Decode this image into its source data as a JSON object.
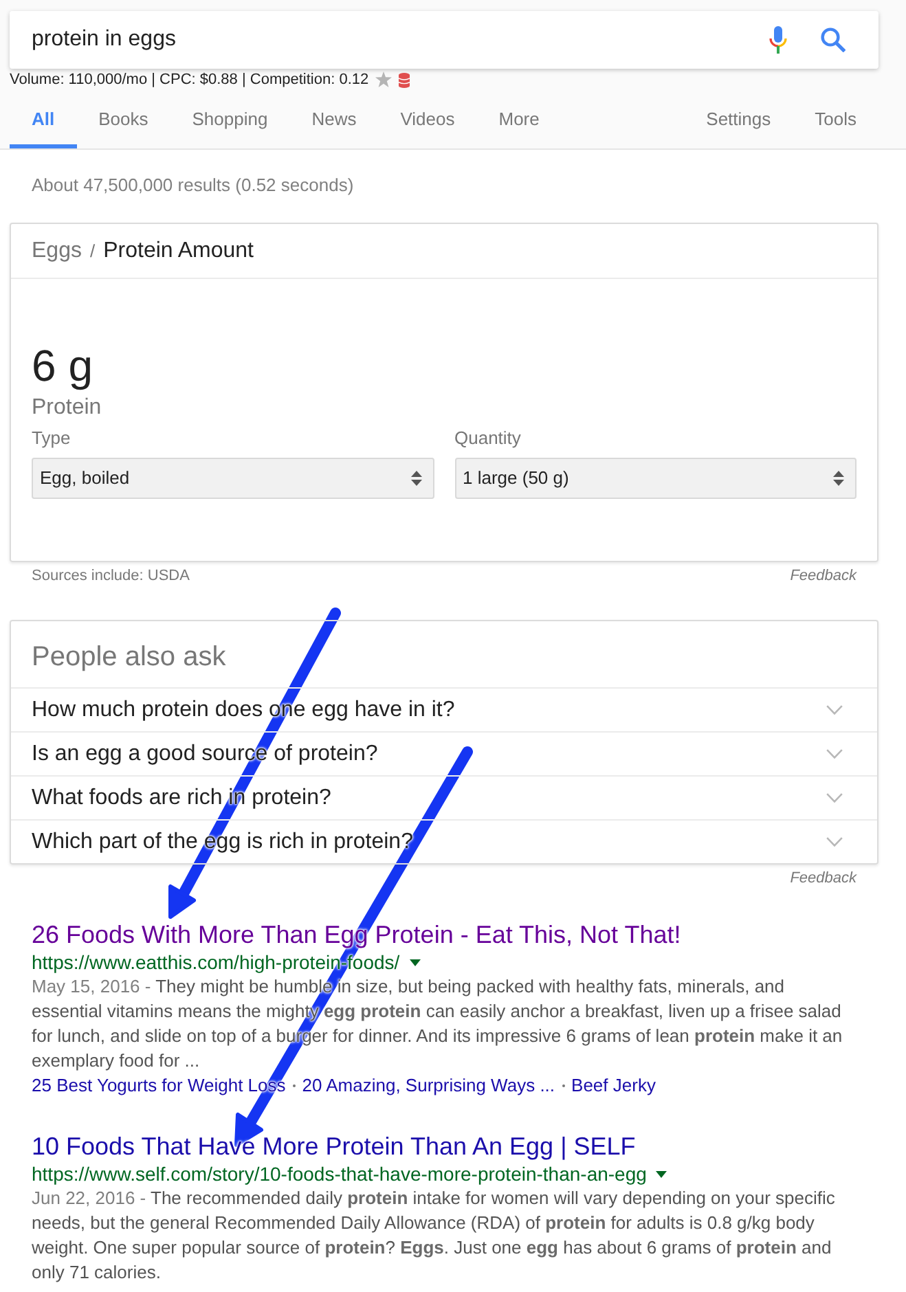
{
  "search": {
    "query": "protein in eggs"
  },
  "keyword_stats": "Volume: 110,000/mo | CPC: $0.88 | Competition: 0.12",
  "tabs": [
    {
      "label": "All",
      "selected": true
    },
    {
      "label": "Books",
      "selected": false
    },
    {
      "label": "Shopping",
      "selected": false
    },
    {
      "label": "News",
      "selected": false
    },
    {
      "label": "Videos",
      "selected": false
    },
    {
      "label": "More",
      "selected": false
    }
  ],
  "tools_menu": [
    "Settings",
    "Tools"
  ],
  "result_stats": "About 47,500,000 results (0.52 seconds)",
  "nutrition_card": {
    "breadcrumb": {
      "parent": "Eggs",
      "separator": "/",
      "current": "Protein Amount"
    },
    "amount": "6 g",
    "nutrient": "Protein",
    "dropdowns": [
      {
        "label": "Type",
        "value": "Egg, boiled"
      },
      {
        "label": "Quantity",
        "value": "1 large (50 g)"
      }
    ],
    "source": "Sources include: USDA",
    "feedback": "Feedback"
  },
  "people_also_ask": {
    "title": "People also ask",
    "questions": [
      {
        "text": "How much protein does one egg have in it?",
        "expanded": false
      },
      {
        "text": "Is an egg a good source of protein?",
        "expanded": false
      },
      {
        "text": "What foods are rich in protein?",
        "expanded": false
      },
      {
        "text": "Which part of the egg is rich in protein?",
        "expanded": false
      }
    ],
    "feedback": "Feedback"
  },
  "results": [
    {
      "title": "26 Foods With More Than Egg Protein - Eat This, Not That!",
      "visited": true,
      "url": "https://www.eatthis.com/high-protein-foods/",
      "date": "May 15, 2016 -",
      "snippet": "They might be humble in size, but being packed with healthy fats, minerals, and essential vitamins means the mighty **egg protein** can easily anchor a breakfast, liven up a frisee salad for lunch, and slide on top of a burger for dinner. And its impressive 6 grams of lean **protein** make it an exemplary food for ...",
      "sitelinks": [
        "25 Best Yogurts for Weight Loss",
        "20 Amazing, Surprising Ways ...",
        "Beef Jerky"
      ]
    },
    {
      "title": "10 Foods That Have More Protein Than An Egg | SELF",
      "visited": false,
      "url": "https://www.self.com/story/10-foods-that-have-more-protein-than-an-egg",
      "date": "Jun 22, 2016 -",
      "snippet": "The recommended daily **protein** intake for women will vary depending on your specific needs, but the general Recommended Daily Allowance (RDA) of **protein** for adults is 0.8 g/kg body weight. One super popular source of **protein**? **Eggs**. Just one **egg** has about 6 grams of **protein** and only 71 calories."
    }
  ]
}
